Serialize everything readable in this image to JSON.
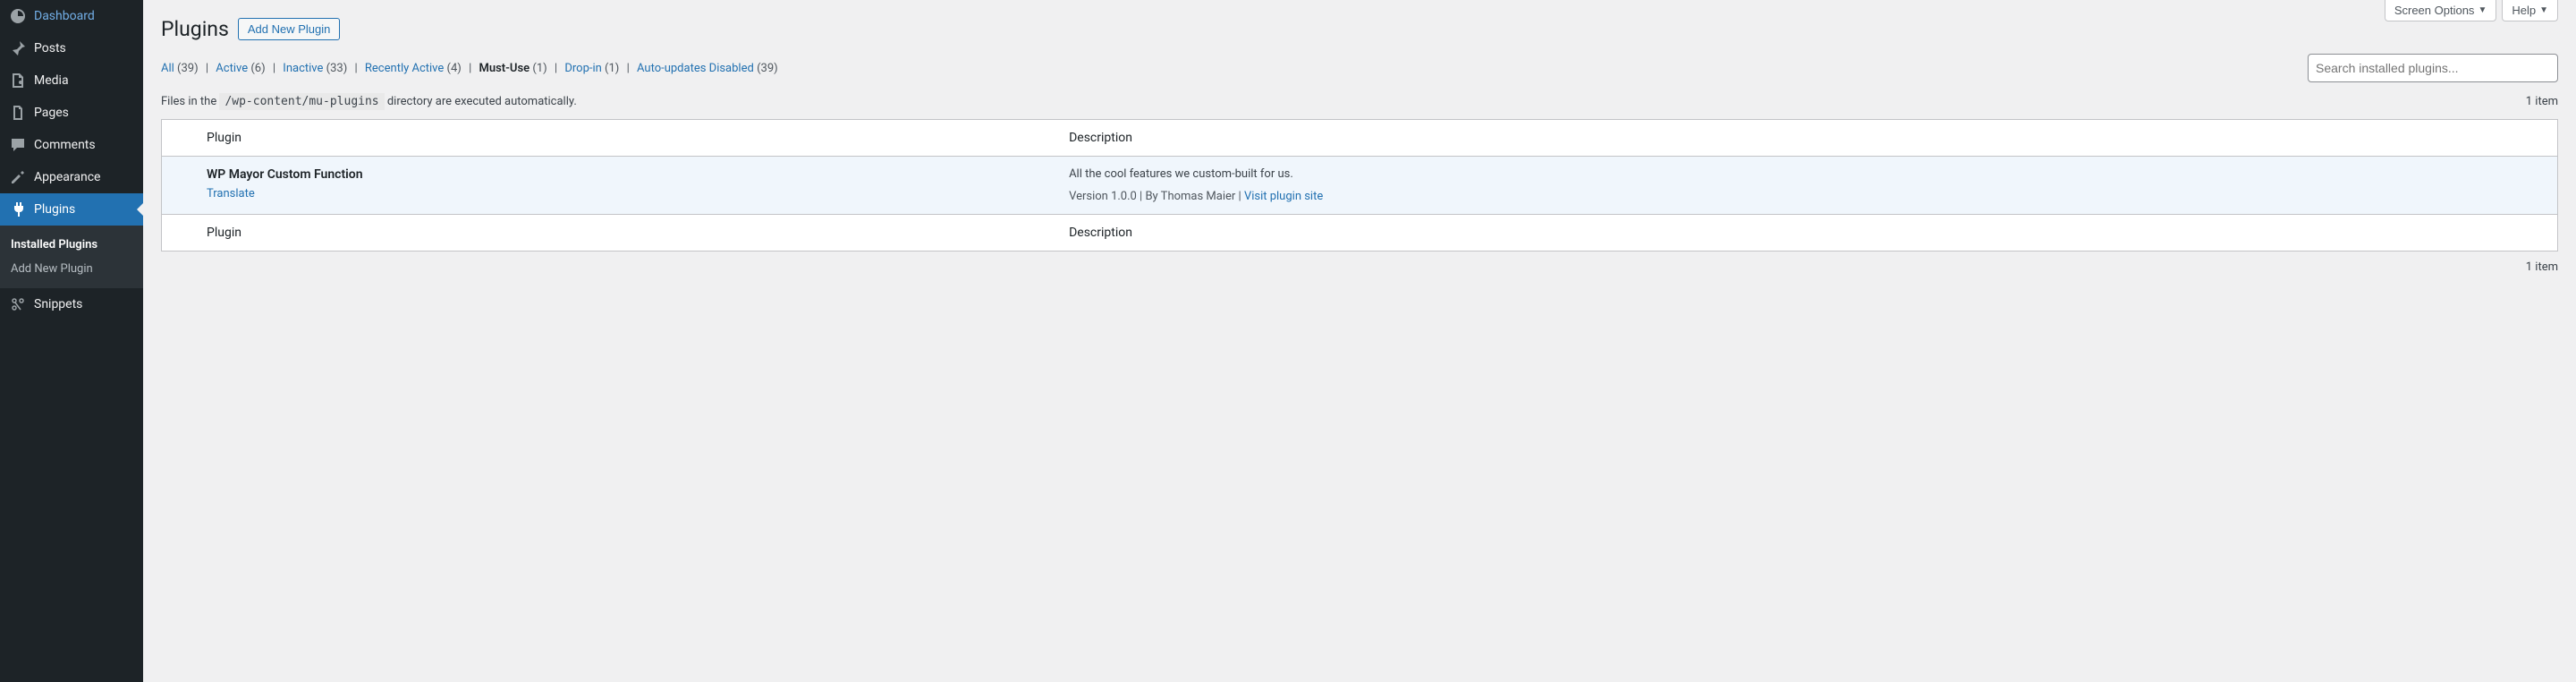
{
  "sidebar": {
    "items": [
      {
        "label": "Dashboard",
        "icon": "dashboard"
      },
      {
        "label": "Posts",
        "icon": "pin"
      },
      {
        "label": "Media",
        "icon": "media"
      },
      {
        "label": "Pages",
        "icon": "pages"
      },
      {
        "label": "Comments",
        "icon": "comments"
      },
      {
        "label": "Appearance",
        "icon": "appearance"
      },
      {
        "label": "Plugins",
        "icon": "plugins",
        "active": true
      },
      {
        "label": "Snippets",
        "icon": "snippets"
      }
    ],
    "submenu": [
      {
        "label": "Installed Plugins",
        "active": true
      },
      {
        "label": "Add New Plugin"
      }
    ]
  },
  "topButtons": {
    "screenOptions": "Screen Options",
    "help": "Help"
  },
  "header": {
    "title": "Plugins",
    "addNew": "Add New Plugin"
  },
  "filters": {
    "all": {
      "label": "All",
      "count": "(39)"
    },
    "active": {
      "label": "Active",
      "count": "(6)"
    },
    "inactive": {
      "label": "Inactive",
      "count": "(33)"
    },
    "recentlyActive": {
      "label": "Recently Active",
      "count": "(4)"
    },
    "mustUse": {
      "label": "Must-Use",
      "count": "(1)"
    },
    "dropIn": {
      "label": "Drop-in",
      "count": "(1)"
    },
    "autoUpdatesDisabled": {
      "label": "Auto-updates Disabled",
      "count": "(39)"
    }
  },
  "search": {
    "placeholder": "Search installed plugins..."
  },
  "info": {
    "prefix": "Files in the ",
    "path": "/wp-content/mu-plugins",
    "suffix": " directory are executed automatically."
  },
  "itemCount": "1 item",
  "table": {
    "colPlugin": "Plugin",
    "colDescription": "Description"
  },
  "plugin": {
    "name": "WP Mayor Custom Function",
    "actionTranslate": "Translate",
    "description": "All the cool features we custom-built for us.",
    "meta": "Version 1.0.0 | By Thomas Maier | ",
    "visitLink": "Visit plugin site"
  }
}
